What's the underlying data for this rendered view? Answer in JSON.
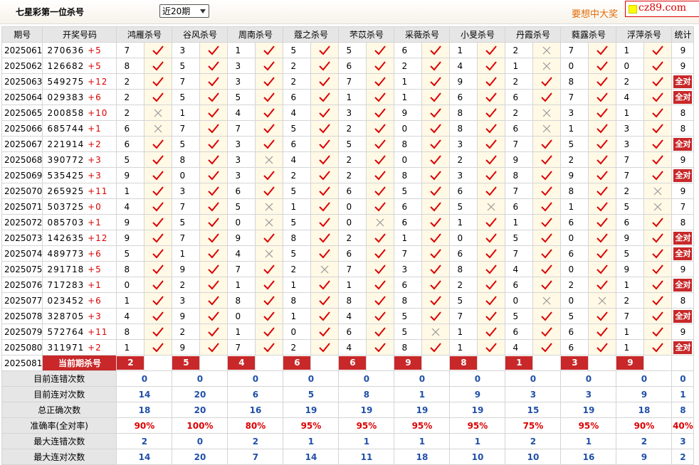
{
  "header": {
    "title": "七星彩第一位杀号",
    "period_select": "近20期",
    "promo": "要想中大奖",
    "site": "cz89.com"
  },
  "columns": {
    "period": "期号",
    "numbers": "开奖号码",
    "count": "统计",
    "experts": [
      "鸿雁杀号",
      "谷风杀号",
      "周南杀号",
      "蔻之杀号",
      "芣苡杀号",
      "采薇杀号",
      "小旻杀号",
      "丹霞杀号",
      "蕤露杀号",
      "浮萍杀号"
    ]
  },
  "rows": [
    {
      "period": "2025061",
      "digits": "270636",
      "plus": "+5",
      "kills": [
        7,
        3,
        1,
        5,
        5,
        6,
        1,
        2,
        7,
        1
      ],
      "marks": [
        1,
        1,
        1,
        1,
        1,
        1,
        1,
        0,
        1,
        1
      ],
      "count": "9"
    },
    {
      "period": "2025062",
      "digits": "126682",
      "plus": "+5",
      "kills": [
        8,
        5,
        3,
        2,
        6,
        2,
        4,
        1,
        0,
        0
      ],
      "marks": [
        1,
        1,
        1,
        1,
        1,
        1,
        1,
        0,
        1,
        1
      ],
      "count": "9"
    },
    {
      "period": "2025063",
      "digits": "549275",
      "plus": "+12",
      "kills": [
        2,
        7,
        3,
        2,
        7,
        1,
        9,
        2,
        8,
        2
      ],
      "marks": [
        1,
        1,
        1,
        1,
        1,
        1,
        1,
        1,
        1,
        1
      ],
      "count": "全对"
    },
    {
      "period": "2025064",
      "digits": "029383",
      "plus": "+6",
      "kills": [
        2,
        5,
        5,
        6,
        1,
        1,
        6,
        6,
        7,
        4
      ],
      "marks": [
        1,
        1,
        1,
        1,
        1,
        1,
        1,
        1,
        1,
        1
      ],
      "count": "全对"
    },
    {
      "period": "2025065",
      "digits": "200858",
      "plus": "+10",
      "kills": [
        2,
        1,
        4,
        4,
        3,
        9,
        8,
        2,
        3,
        1
      ],
      "marks": [
        0,
        1,
        1,
        1,
        1,
        1,
        1,
        0,
        1,
        1
      ],
      "count": "8"
    },
    {
      "period": "2025066",
      "digits": "685744",
      "plus": "+1",
      "kills": [
        6,
        7,
        7,
        5,
        2,
        0,
        8,
        6,
        1,
        3
      ],
      "marks": [
        0,
        1,
        1,
        1,
        1,
        1,
        1,
        0,
        1,
        1
      ],
      "count": "8"
    },
    {
      "period": "2025067",
      "digits": "221914",
      "plus": "+2",
      "kills": [
        6,
        5,
        3,
        6,
        5,
        8,
        3,
        7,
        5,
        3
      ],
      "marks": [
        1,
        1,
        1,
        1,
        1,
        1,
        1,
        1,
        1,
        1
      ],
      "count": "全对"
    },
    {
      "period": "2025068",
      "digits": "390772",
      "plus": "+3",
      "kills": [
        5,
        8,
        3,
        4,
        2,
        0,
        2,
        9,
        2,
        7
      ],
      "marks": [
        1,
        1,
        0,
        1,
        1,
        1,
        1,
        1,
        1,
        1
      ],
      "count": "9"
    },
    {
      "period": "2025069",
      "digits": "535425",
      "plus": "+3",
      "kills": [
        9,
        0,
        3,
        2,
        2,
        8,
        3,
        8,
        9,
        7
      ],
      "marks": [
        1,
        1,
        1,
        1,
        1,
        1,
        1,
        1,
        1,
        1
      ],
      "count": "全对"
    },
    {
      "period": "2025070",
      "digits": "265925",
      "plus": "+11",
      "kills": [
        1,
        3,
        6,
        5,
        6,
        5,
        6,
        7,
        8,
        2
      ],
      "marks": [
        1,
        1,
        1,
        1,
        1,
        1,
        1,
        1,
        1,
        0
      ],
      "count": "9"
    },
    {
      "period": "2025071",
      "digits": "503725",
      "plus": "+0",
      "kills": [
        4,
        7,
        5,
        1,
        0,
        6,
        5,
        6,
        1,
        5
      ],
      "marks": [
        1,
        1,
        0,
        1,
        1,
        1,
        0,
        1,
        1,
        0
      ],
      "count": "7"
    },
    {
      "period": "2025072",
      "digits": "085703",
      "plus": "+1",
      "kills": [
        9,
        5,
        0,
        5,
        0,
        6,
        1,
        1,
        6,
        6
      ],
      "marks": [
        1,
        1,
        0,
        1,
        0,
        1,
        1,
        1,
        1,
        1
      ],
      "count": "8"
    },
    {
      "period": "2025073",
      "digits": "142635",
      "plus": "+12",
      "kills": [
        9,
        7,
        9,
        8,
        2,
        1,
        0,
        5,
        0,
        9
      ],
      "marks": [
        1,
        1,
        1,
        1,
        1,
        1,
        1,
        1,
        1,
        1
      ],
      "count": "全对"
    },
    {
      "period": "2025074",
      "digits": "489773",
      "plus": "+6",
      "kills": [
        5,
        1,
        4,
        5,
        6,
        7,
        6,
        7,
        6,
        5
      ],
      "marks": [
        1,
        1,
        0,
        1,
        1,
        1,
        1,
        1,
        1,
        1
      ],
      "count": "全对"
    },
    {
      "period": "2025075",
      "digits": "291718",
      "plus": "+5",
      "kills": [
        8,
        9,
        7,
        2,
        7,
        3,
        8,
        4,
        0,
        9
      ],
      "marks": [
        1,
        1,
        1,
        0,
        1,
        1,
        1,
        1,
        1,
        1
      ],
      "count": "9"
    },
    {
      "period": "2025076",
      "digits": "717283",
      "plus": "+1",
      "kills": [
        0,
        2,
        1,
        1,
        1,
        6,
        2,
        6,
        2,
        1
      ],
      "marks": [
        1,
        1,
        1,
        1,
        1,
        1,
        1,
        1,
        1,
        1
      ],
      "count": "全对"
    },
    {
      "period": "2025077",
      "digits": "023452",
      "plus": "+6",
      "kills": [
        1,
        3,
        8,
        8,
        8,
        8,
        5,
        0,
        0,
        2
      ],
      "marks": [
        1,
        1,
        1,
        1,
        1,
        1,
        1,
        0,
        0,
        1
      ],
      "count": "8"
    },
    {
      "period": "2025078",
      "digits": "328705",
      "plus": "+3",
      "kills": [
        4,
        9,
        0,
        1,
        4,
        5,
        7,
        5,
        5,
        7
      ],
      "marks": [
        1,
        1,
        1,
        1,
        1,
        1,
        1,
        1,
        1,
        1
      ],
      "count": "全对"
    },
    {
      "period": "2025079",
      "digits": "572764",
      "plus": "+11",
      "kills": [
        8,
        2,
        1,
        0,
        6,
        5,
        1,
        6,
        6,
        1
      ],
      "marks": [
        1,
        1,
        1,
        1,
        1,
        0,
        1,
        1,
        1,
        1
      ],
      "count": "9"
    },
    {
      "period": "2025080",
      "digits": "311971",
      "plus": "+2",
      "kills": [
        1,
        9,
        7,
        2,
        4,
        8,
        1,
        4,
        6,
        1
      ],
      "marks": [
        1,
        1,
        1,
        1,
        1,
        1,
        1,
        1,
        1,
        1
      ],
      "count": "全对"
    }
  ],
  "current": {
    "period": "2025081",
    "label": "当前期杀号",
    "kills": [
      "2",
      "5",
      "4",
      "6",
      "6",
      "9",
      "8",
      "1",
      "3",
      "9"
    ]
  },
  "stats": [
    {
      "label": "目前连错次数",
      "values": [
        "0",
        "0",
        "0",
        "0",
        "0",
        "0",
        "0",
        "0",
        "0",
        "0"
      ],
      "total": "0",
      "color": "blue"
    },
    {
      "label": "目前连对次数",
      "values": [
        "14",
        "20",
        "6",
        "5",
        "8",
        "1",
        "9",
        "3",
        "3",
        "9"
      ],
      "total": "1",
      "color": "blue"
    },
    {
      "label": "总正确次数",
      "values": [
        "18",
        "20",
        "16",
        "19",
        "19",
        "19",
        "19",
        "15",
        "19",
        "18"
      ],
      "total": "8",
      "color": "blue"
    },
    {
      "label": "准确率(全对率)",
      "values": [
        "90%",
        "100%",
        "80%",
        "95%",
        "95%",
        "95%",
        "95%",
        "75%",
        "95%",
        "90%"
      ],
      "total": "40%",
      "color": "red"
    },
    {
      "label": "最大连错次数",
      "values": [
        "2",
        "0",
        "2",
        "1",
        "1",
        "1",
        "1",
        "2",
        "1",
        "2"
      ],
      "total": "3",
      "color": "blue"
    },
    {
      "label": "最大连对次数",
      "values": [
        "14",
        "20",
        "7",
        "14",
        "11",
        "18",
        "10",
        "10",
        "16",
        "9"
      ],
      "total": "2",
      "color": "blue"
    }
  ]
}
